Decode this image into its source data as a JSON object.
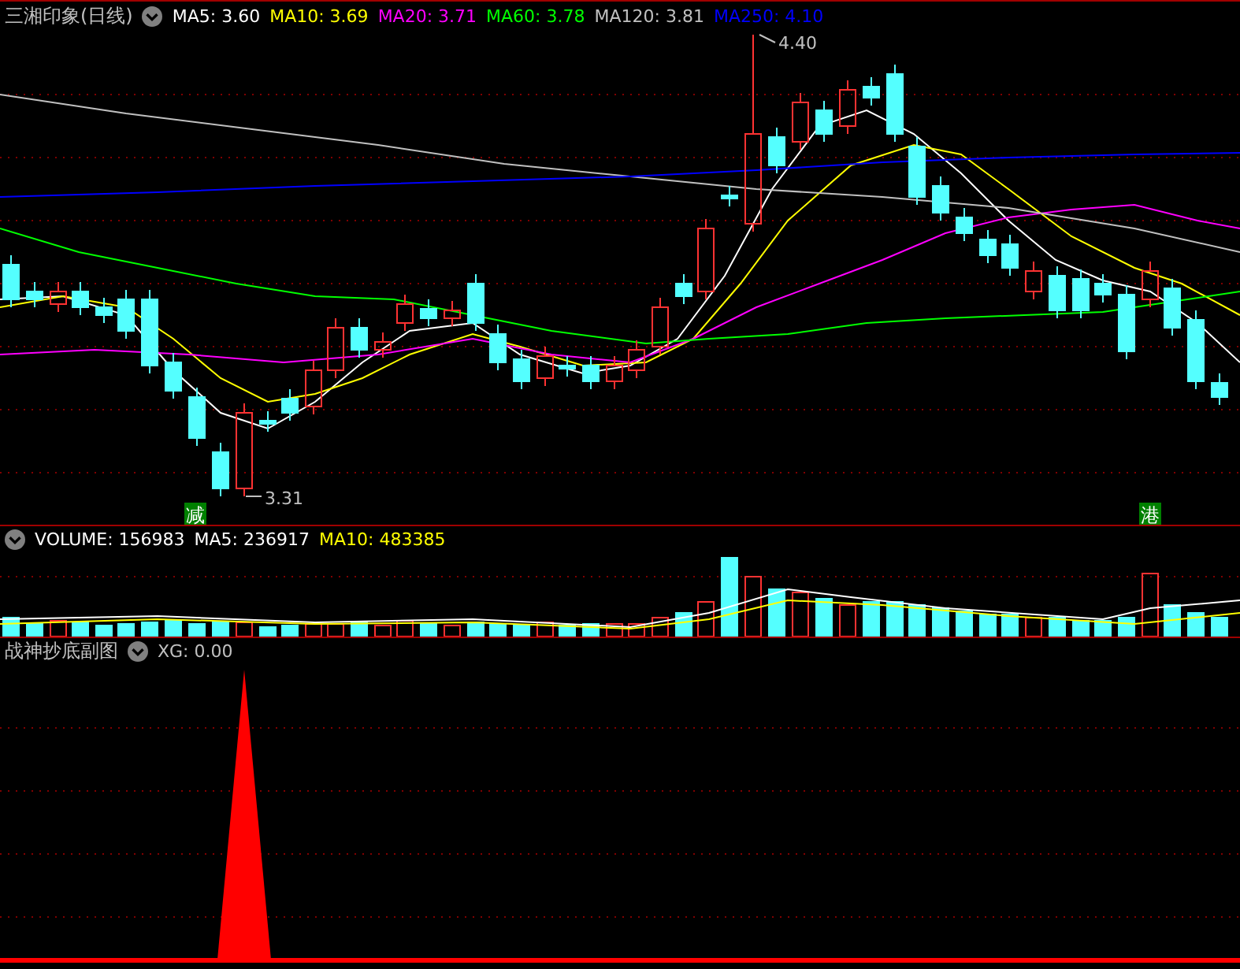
{
  "main_panel": {
    "title": "三湘印象(日线)",
    "indicators": [
      {
        "label": "MA5:",
        "value": "3.60",
        "color": "#ffffff"
      },
      {
        "label": "MA10:",
        "value": "3.69",
        "color": "#ffff00"
      },
      {
        "label": "MA20:",
        "value": "3.71",
        "color": "#ff00ff"
      },
      {
        "label": "MA60:",
        "value": "3.78",
        "color": "#00ff00"
      },
      {
        "label": "MA120:",
        "value": "3.81",
        "color": "#c0c0c0"
      },
      {
        "label": "MA250:",
        "value": "4.10",
        "color": "#0000ff"
      }
    ],
    "high_label": "4.40",
    "low_label": "3.31",
    "tags": [
      "减",
      "港"
    ]
  },
  "volume_panel": {
    "indicators": [
      {
        "label": "VOLUME:",
        "value": "156983",
        "color": "#ffffff"
      },
      {
        "label": "MA5:",
        "value": "236917",
        "color": "#ffffff"
      },
      {
        "label": "MA10:",
        "value": "483385",
        "color": "#ffff00"
      }
    ]
  },
  "indicator_panel": {
    "title": "战神抄底副图",
    "indicators": [
      {
        "label": "XG:",
        "value": "0.00",
        "color": "#c0c0c0"
      }
    ]
  }
}
